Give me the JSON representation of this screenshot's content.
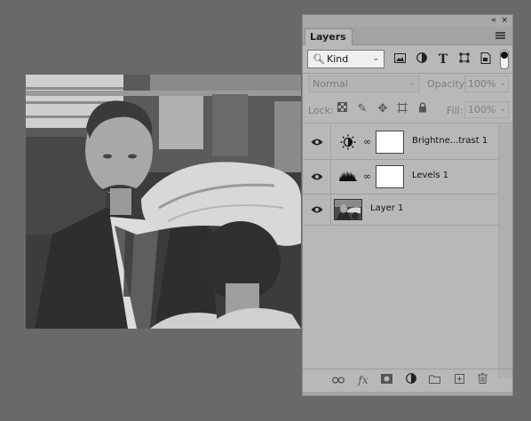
{
  "panel": {
    "collapse_icon": "double-chevron-left-icon",
    "close_icon": "close-icon",
    "tab_title": "Layers",
    "menu_icon": "hamburger-menu-icon"
  },
  "filter": {
    "kind_label": "Kind",
    "icons": [
      "pixel-layer-filter-icon",
      "adjustment-layer-filter-icon",
      "type-layer-filter-icon",
      "shape-layer-filter-icon",
      "smart-object-filter-icon"
    ]
  },
  "blend": {
    "mode": "Normal",
    "opacity_label": "Opacity:",
    "opacity_value": "100%"
  },
  "lock": {
    "label": "Lock:",
    "icons": [
      "lock-transparent-pixels-icon",
      "lock-image-pixels-icon",
      "lock-position-icon",
      "lock-artboard-icon",
      "lock-all-icon"
    ],
    "fill_label": "Fill:",
    "fill_value": "100%"
  },
  "layers": [
    {
      "name": "Brightne...trast 1",
      "type": "adjustment",
      "icon": "brightness-contrast-icon",
      "visible": true
    },
    {
      "name": "Levels 1",
      "type": "adjustment",
      "icon": "levels-histogram-icon",
      "visible": true
    },
    {
      "name": "Layer 1",
      "type": "pixel",
      "icon": "photo-thumbnail",
      "visible": true
    }
  ],
  "bottom_icons": [
    "link-layers-icon",
    "fx-layer-style-icon",
    "add-mask-icon",
    "new-fill-adjustment-icon",
    "new-group-folder-icon",
    "new-layer-icon",
    "delete-trash-icon"
  ],
  "colors": {
    "workspace": "#696969",
    "panel_bg": "#b8b8b8"
  }
}
